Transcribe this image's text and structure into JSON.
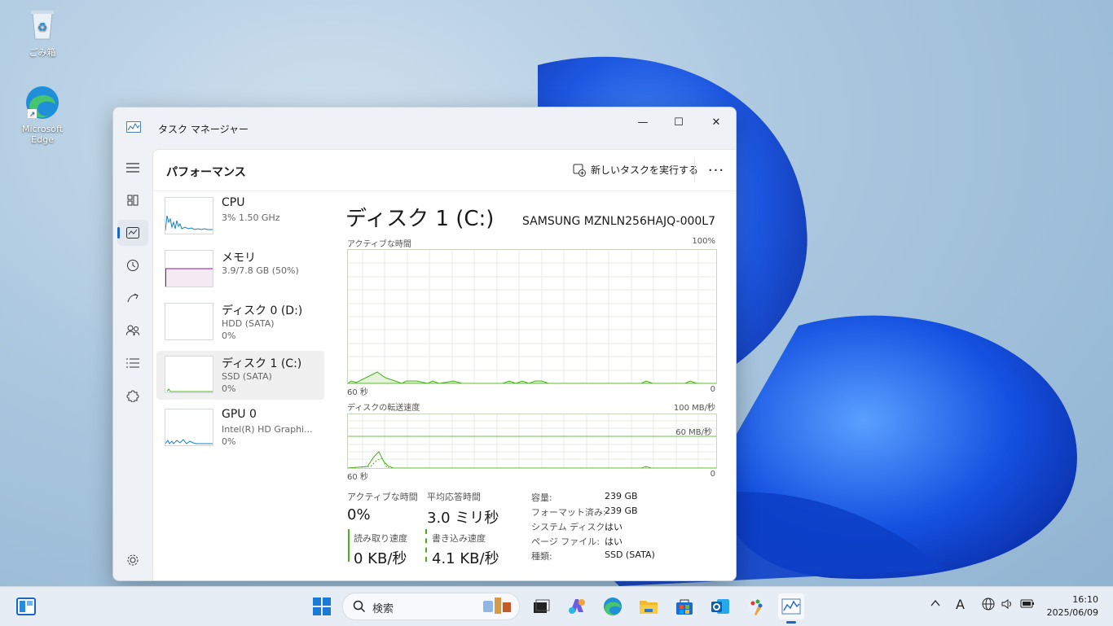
{
  "desktop": {
    "icons": [
      {
        "label": "ごみ箱",
        "icon": "recycle-bin-icon"
      },
      {
        "label": "Microsoft Edge",
        "icon": "edge-icon"
      }
    ]
  },
  "window": {
    "title": "タスク マネージャー",
    "controls": {
      "minimize": "—",
      "maximize": "☐",
      "close": "✕"
    }
  },
  "header": {
    "page_title": "パフォーマンス",
    "run_task_label": "新しいタスクを実行する",
    "more_label": "···"
  },
  "devices": [
    {
      "name": "CPU",
      "sub": "3%  1.50 GHz",
      "pct": "",
      "color": "#1a80c4"
    },
    {
      "name": "メモリ",
      "sub": "3.9/7.8 GB (50%)",
      "pct": "",
      "color": "#8b1a8b"
    },
    {
      "name": "ディスク 0 (D:)",
      "sub": "HDD (SATA)",
      "pct": "0%",
      "color": "#4caf1e"
    },
    {
      "name": "ディスク 1 (C:)",
      "sub": "SSD (SATA)",
      "pct": "0%",
      "color": "#4caf1e"
    },
    {
      "name": "GPU 0",
      "sub": "Intel(R) HD Graphi...",
      "pct": "0%",
      "color": "#1a80c4"
    }
  ],
  "detail": {
    "title": "ディスク 1 (C:)",
    "model": "SAMSUNG MZNLN256HAJQ-000L7",
    "graph1": {
      "label": "アクティブな時間",
      "max": "100%",
      "xleft": "60 秒",
      "xright": "0"
    },
    "graph2": {
      "label": "ディスクの転送速度",
      "max": "100 MB/秒",
      "mid": "60 MB/秒",
      "xleft": "60 秒",
      "xright": "0"
    },
    "stats": {
      "active_label": "アクティブな時間",
      "active_value": "0%",
      "resp_label": "平均応答時間",
      "resp_value": "3.0 ミリ秒",
      "read_label": "読み取り速度",
      "read_value": "0 KB/秒",
      "write_label": "書き込み速度",
      "write_value": "4.1 KB/秒"
    },
    "properties": [
      {
        "key": "容量:",
        "value": "239 GB"
      },
      {
        "key": "フォーマット済み:",
        "value": "239 GB"
      },
      {
        "key": "システム ディスク:",
        "value": "はい"
      },
      {
        "key": "ページ ファイル:",
        "value": "はい"
      },
      {
        "key": "種類:",
        "value": "SSD (SATA)"
      }
    ]
  },
  "taskbar": {
    "search_placeholder": "検索",
    "tray_ime": "A",
    "clock_time": "16:10",
    "clock_date": "2025/06/09"
  },
  "colors": {
    "accent": "#1a66c2",
    "disk_green": "#4caf1e"
  }
}
